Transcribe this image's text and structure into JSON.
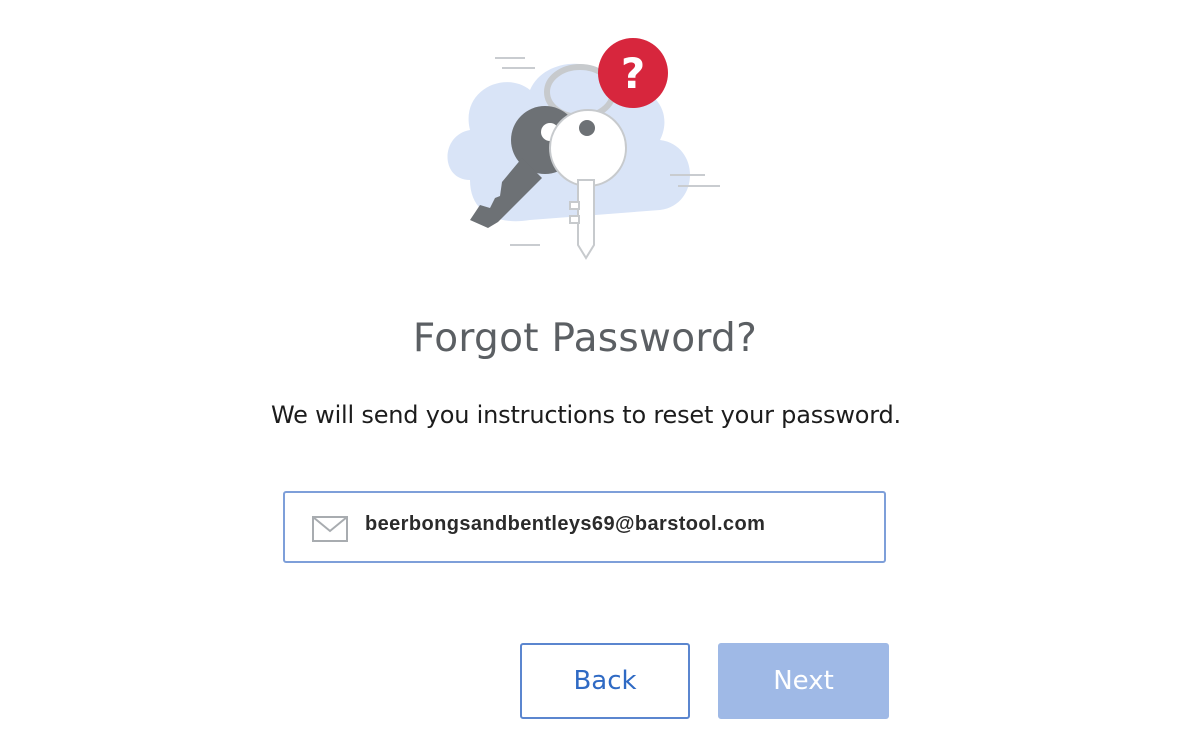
{
  "illustration": {
    "icon": "keys-with-question-icon",
    "colors": {
      "cloud": "#d9e4f7",
      "dark_key": "#6d7175",
      "light_key": "#ffffff",
      "question_badge": "#d7263d"
    },
    "badge_text": "?"
  },
  "heading": {
    "title": "Forgot Password?",
    "subtitle": "We will send you instructions to reset your password."
  },
  "form": {
    "email_icon": "envelope-icon",
    "email_value": "beerbongsandbentleys69@barstool.com",
    "accent_color": "#7e9fd9"
  },
  "actions": {
    "back_label": "Back",
    "next_label": "Next",
    "next_color": "#9fb9e6"
  }
}
